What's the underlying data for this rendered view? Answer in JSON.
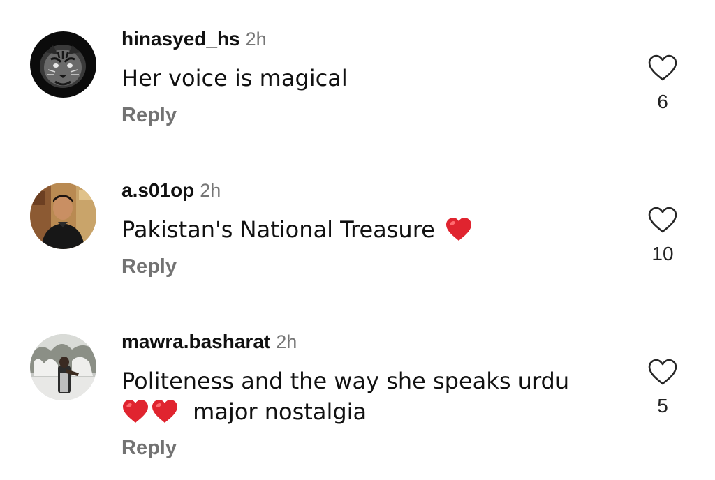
{
  "comments": [
    {
      "username": "hinasyed_hs",
      "time": "2h",
      "text": "Her voice is magical",
      "reply_label": "Reply",
      "like_count": "6",
      "avatar": "tiger-avatar"
    },
    {
      "username": "a.s01op",
      "time": "2h",
      "text": "Pakistan's National Treasure",
      "emoji": "red-heart",
      "reply_label": "Reply",
      "like_count": "10",
      "avatar": "person-avatar"
    },
    {
      "username": "mawra.basharat",
      "time": "2h",
      "text_line1": "Politeness and the way she speaks urdu",
      "text_line2": "major nostalgia",
      "emoji": "red-heart",
      "reply_label": "Reply",
      "like_count": "5",
      "avatar": "snow-scene-avatar"
    }
  ],
  "icons": {
    "like": "heart-outline-icon",
    "emoji_heart_color": "#e0242f"
  },
  "colors": {
    "username": "#111111",
    "time": "#757575",
    "reply": "#737373",
    "text": "#111111"
  }
}
